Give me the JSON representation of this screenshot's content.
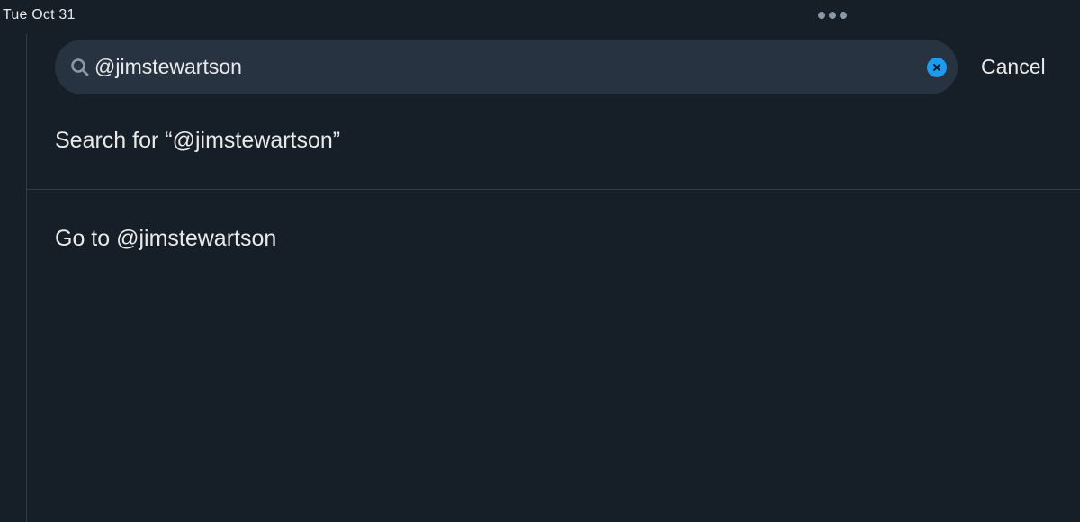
{
  "status_bar": {
    "date": "Tue Oct 31"
  },
  "search": {
    "query": "@jimstewartson",
    "cancel_label": "Cancel"
  },
  "results": {
    "search_for_label": "Search for “@jimstewartson”",
    "go_to_label": "Go to @jimstewartson"
  },
  "colors": {
    "background": "#161e28",
    "search_field": "#273340",
    "accent": "#1d9bf0",
    "text": "#e7e9ea",
    "divider": "#2f3b47"
  },
  "icons": {
    "search": "search-icon",
    "clear": "clear-icon",
    "more": "more-dots-icon"
  }
}
